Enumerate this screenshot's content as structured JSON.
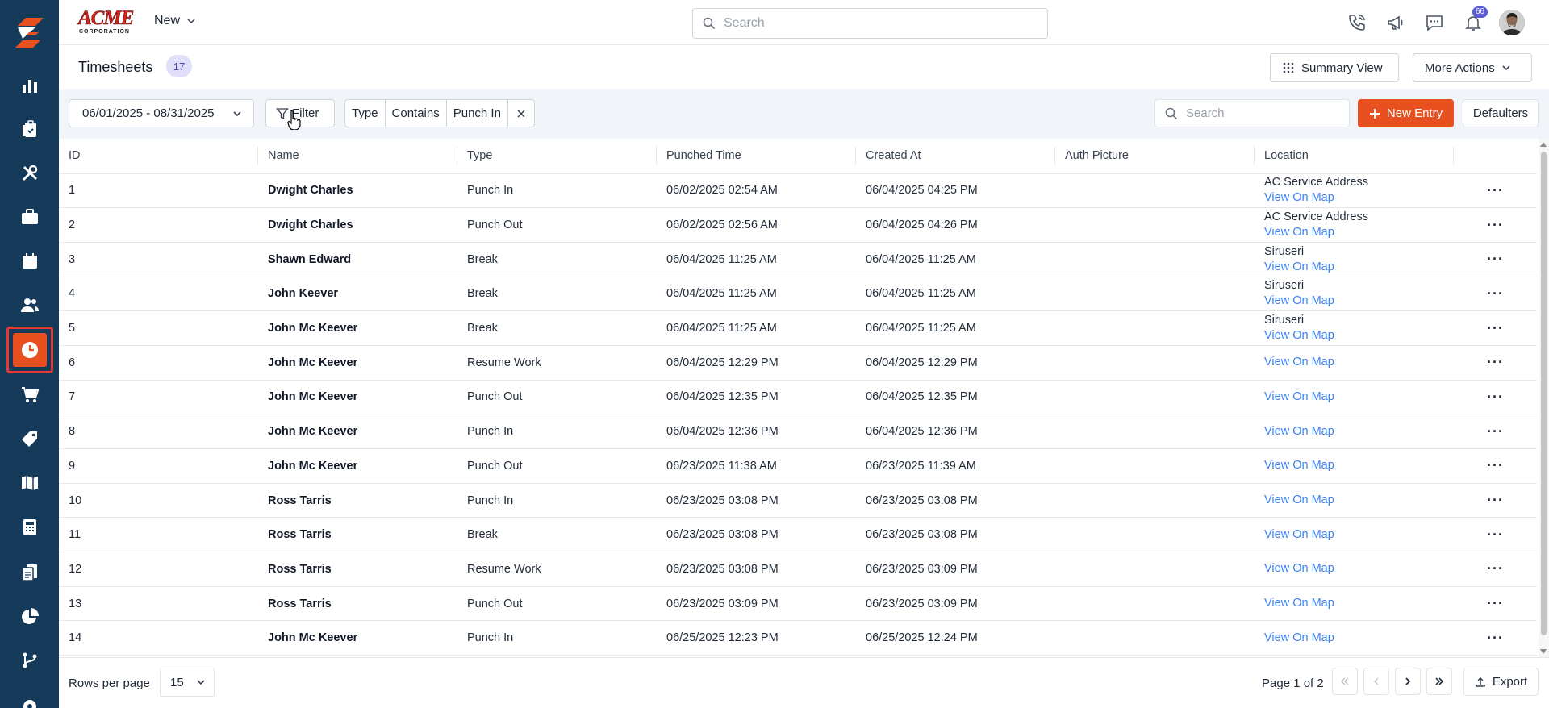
{
  "brand": {
    "logo_text": "ACME",
    "logo_subtext": "CORPORATION"
  },
  "header": {
    "new_label": "New",
    "search_placeholder": "Search",
    "notification_count": "66",
    "icons": [
      "phone-icon",
      "megaphone-icon",
      "chat-icon",
      "bell-icon"
    ]
  },
  "sidebar": {
    "items": [
      {
        "name": "reports",
        "icon": "bar-chart-icon"
      },
      {
        "name": "clipboard",
        "icon": "clipboard-icon"
      },
      {
        "name": "tools",
        "icon": "tools-icon"
      },
      {
        "name": "jobs",
        "icon": "briefcase-icon"
      },
      {
        "name": "calendar",
        "icon": "calendar-icon"
      },
      {
        "name": "customers",
        "icon": "users-icon"
      },
      {
        "name": "timesheets",
        "icon": "clock-icon",
        "active": true
      },
      {
        "name": "purchase",
        "icon": "cart-icon"
      },
      {
        "name": "pricebook",
        "icon": "tag-icon"
      },
      {
        "name": "map",
        "icon": "map-icon"
      },
      {
        "name": "calculator",
        "icon": "calculator-icon"
      },
      {
        "name": "documents",
        "icon": "documents-icon"
      },
      {
        "name": "analytics",
        "icon": "pie-chart-icon"
      },
      {
        "name": "workflow",
        "icon": "workflow-icon"
      },
      {
        "name": "settings",
        "icon": "gear-icon"
      }
    ]
  },
  "page": {
    "title": "Timesheets",
    "count": "17",
    "summary_view_label": "Summary View",
    "more_actions_label": "More Actions"
  },
  "filters": {
    "date_range": "06/01/2025 - 08/31/2025",
    "filter_label": "Filter",
    "chips": [
      "Type",
      "Contains",
      "Punch In"
    ],
    "search_placeholder": "Search",
    "new_entry_label": "New Entry",
    "defaulters_label": "Defaulters"
  },
  "table": {
    "columns": [
      "ID",
      "Name",
      "Type",
      "Punched Time",
      "Created At",
      "Auth Picture",
      "Location"
    ],
    "map_link_label": "View On Map",
    "rows": [
      {
        "id": "1",
        "name": "Dwight Charles",
        "type": "Punch In",
        "punched": "06/02/2025 02:54 AM",
        "created": "06/04/2025 04:25 PM",
        "location": "AC Service Address",
        "link": "View On Map"
      },
      {
        "id": "2",
        "name": "Dwight Charles",
        "type": "Punch Out",
        "punched": "06/02/2025 02:56 AM",
        "created": "06/04/2025 04:26 PM",
        "location": "AC Service Address",
        "link": "View On Map"
      },
      {
        "id": "3",
        "name": "Shawn Edward",
        "type": "Break",
        "punched": "06/04/2025 11:25 AM",
        "created": "06/04/2025 11:25 AM",
        "location": "Siruseri",
        "link": "View On Map"
      },
      {
        "id": "4",
        "name": "John Keever",
        "type": "Break",
        "punched": "06/04/2025 11:25 AM",
        "created": "06/04/2025 11:25 AM",
        "location": "Siruseri",
        "link": "View On Map"
      },
      {
        "id": "5",
        "name": "John Mc Keever",
        "type": "Break",
        "punched": "06/04/2025 11:25 AM",
        "created": "06/04/2025 11:25 AM",
        "location": "Siruseri",
        "link": "View On Map"
      },
      {
        "id": "6",
        "name": "John Mc Keever",
        "type": "Resume Work",
        "punched": "06/04/2025 12:29 PM",
        "created": "06/04/2025 12:29 PM",
        "location": "",
        "link": "View On Map"
      },
      {
        "id": "7",
        "name": "John Mc Keever",
        "type": "Punch Out",
        "punched": "06/04/2025 12:35 PM",
        "created": "06/04/2025 12:35 PM",
        "location": "",
        "link": "View On Map"
      },
      {
        "id": "8",
        "name": "John Mc Keever",
        "type": "Punch In",
        "punched": "06/04/2025 12:36 PM",
        "created": "06/04/2025 12:36 PM",
        "location": "",
        "link": "View On Map"
      },
      {
        "id": "9",
        "name": "John Mc Keever",
        "type": "Punch Out",
        "punched": "06/23/2025 11:38 AM",
        "created": "06/23/2025 11:39 AM",
        "location": "",
        "link": "View On Map"
      },
      {
        "id": "10",
        "name": "Ross Tarris",
        "type": "Punch In",
        "punched": "06/23/2025 03:08 PM",
        "created": "06/23/2025 03:08 PM",
        "location": "",
        "link": "View On Map"
      },
      {
        "id": "11",
        "name": "Ross Tarris",
        "type": "Break",
        "punched": "06/23/2025 03:08 PM",
        "created": "06/23/2025 03:08 PM",
        "location": "",
        "link": "View On Map"
      },
      {
        "id": "12",
        "name": "Ross Tarris",
        "type": "Resume Work",
        "punched": "06/23/2025 03:08 PM",
        "created": "06/23/2025 03:09 PM",
        "location": "",
        "link": "View On Map"
      },
      {
        "id": "13",
        "name": "Ross Tarris",
        "type": "Punch Out",
        "punched": "06/23/2025 03:09 PM",
        "created": "06/23/2025 03:09 PM",
        "location": "",
        "link": "View On Map"
      },
      {
        "id": "14",
        "name": "John Mc Keever",
        "type": "Punch In",
        "punched": "06/25/2025 12:23 PM",
        "created": "06/25/2025 12:24 PM",
        "location": "",
        "link": "View On Map"
      }
    ]
  },
  "footer": {
    "rows_per_page_label": "Rows per page",
    "rows_per_page_value": "15",
    "page_info": "Page 1 of 2",
    "export_label": "Export"
  },
  "colors": {
    "accent": "#e8501f",
    "sidebar": "#163a5a",
    "link": "#3b82f6",
    "badge": "#e0def9"
  }
}
